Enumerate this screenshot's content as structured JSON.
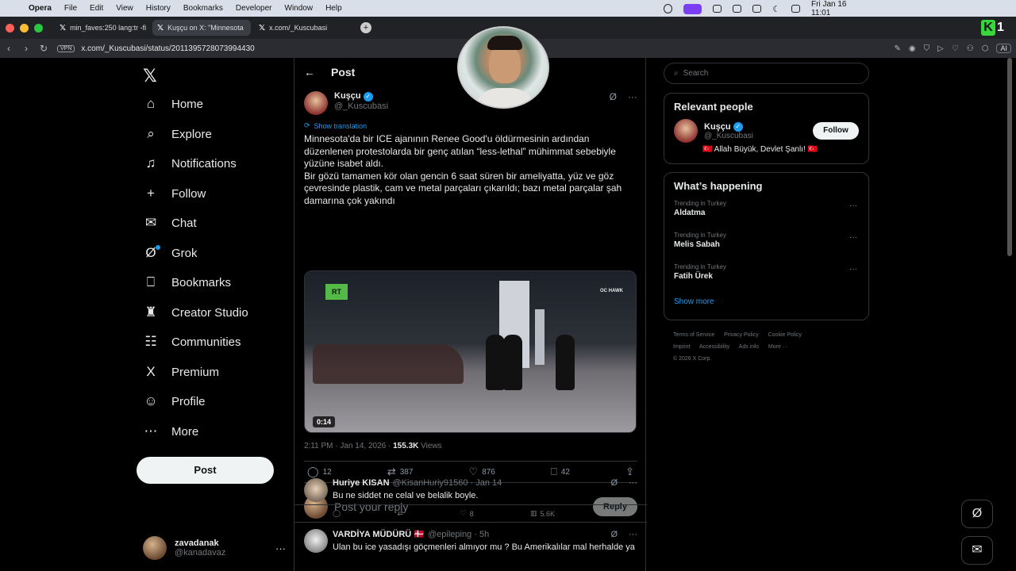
{
  "menubar": {
    "app": "Opera",
    "items": [
      "File",
      "Edit",
      "View",
      "History",
      "Bookmarks",
      "Developer",
      "Window",
      "Help"
    ],
    "clock": "Fri Jan 16  11:01"
  },
  "tabs": [
    {
      "title": "min_faves:250 lang:tr -fi"
    },
    {
      "title": "Kuşçu on X: \"Minnesota"
    },
    {
      "title": "x.com/_Kuscubasi"
    }
  ],
  "address": {
    "vpn": "VPN",
    "url": "x.com/_Kuscubasi/status/2011395728073994430",
    "ai": "AI"
  },
  "nav": {
    "items": [
      {
        "label": "Home",
        "icon": "⌂"
      },
      {
        "label": "Explore",
        "icon": "⌕"
      },
      {
        "label": "Notifications",
        "icon": "♫"
      },
      {
        "label": "Follow",
        "icon": "+"
      },
      {
        "label": "Chat",
        "icon": "✉"
      },
      {
        "label": "Grok",
        "icon": "Ø"
      },
      {
        "label": "Bookmarks",
        "icon": "⎕"
      },
      {
        "label": "Creator Studio",
        "icon": "♜"
      },
      {
        "label": "Communities",
        "icon": "☷"
      },
      {
        "label": "Premium",
        "icon": "X"
      },
      {
        "label": "Profile",
        "icon": "☺"
      },
      {
        "label": "More",
        "icon": "⋯"
      }
    ],
    "post_button": "Post",
    "me": {
      "name": "zavadanak",
      "handle": "@kanadavaz"
    }
  },
  "main": {
    "header": "Post",
    "tweet": {
      "name": "Kuşçu",
      "handle": "@_Kuscubasi",
      "show_translation": "Show translation",
      "text1": "Minnesota'da bir ICE ajanının Renee Good'u öldürmesinin ardından düzenlenen protestolarda bir genç atılan “less-lethal” mühimmat sebebiyle yüzüne isabet aldı.",
      "text2": "Bir gözü tamamen kör olan gencin 6 saat süren bir ameliyatta, yüz ve göz çevresinde plastik, cam ve metal parçaları çıkarıldı; bazı metal parçalar şah damarına çok yakındı",
      "video_duration": "0:14",
      "video_logo": "RT",
      "video_watermark": "OC HAWK",
      "time": "2:11 PM · Jan 14, 2026 · ",
      "views": "155.3K",
      "views_label": " Views",
      "replies": "12",
      "reposts": "387",
      "likes": "876",
      "bookmarks": "42"
    },
    "reply_placeholder": "Post your reply",
    "reply_button": "Reply",
    "replies": [
      {
        "name": "Huriye KISAN",
        "handle": "@KisanHuriy91560 · Jan 14",
        "text": "Bu ne siddet ne celal ve belalik boyle.",
        "likes": "8",
        "views": "5.6K"
      },
      {
        "name": "VARDİYA MÜDÜRÜ 🇩🇰",
        "handle": "@epileping · 5h",
        "text": "Ulan bu ice yasadışı göçmenleri almıyor mu ? Bu Amerikalılar mal herhalde ya"
      }
    ]
  },
  "right": {
    "search_placeholder": "Search",
    "relevant_title": "Relevant people",
    "person": {
      "name": "Kuşçu",
      "handle": "@_Kuscubasi",
      "bio": "🇹🇷 Allah Büyük, Devlet Şanlı! 🇹🇷",
      "follow": "Follow"
    },
    "happening_title": "What’s happening",
    "trends": [
      {
        "label": "Trending in Turkey",
        "name": "Aldatma"
      },
      {
        "label": "Trending in Turkey",
        "name": "Melis Sabah"
      },
      {
        "label": "Trending in Turkey",
        "name": "Fatih Ürek"
      }
    ],
    "show_more": "Show more",
    "footer": [
      "Terms of Service",
      "Privacy Policy",
      "Cookie Policy",
      "Imprint",
      "Accessibility",
      "Ads info",
      "More ···",
      "© 2026 X Corp."
    ]
  },
  "colors": {
    "accent": "#1d9bf0",
    "background": "#000000",
    "opera_purple": "#7b3ef2"
  }
}
